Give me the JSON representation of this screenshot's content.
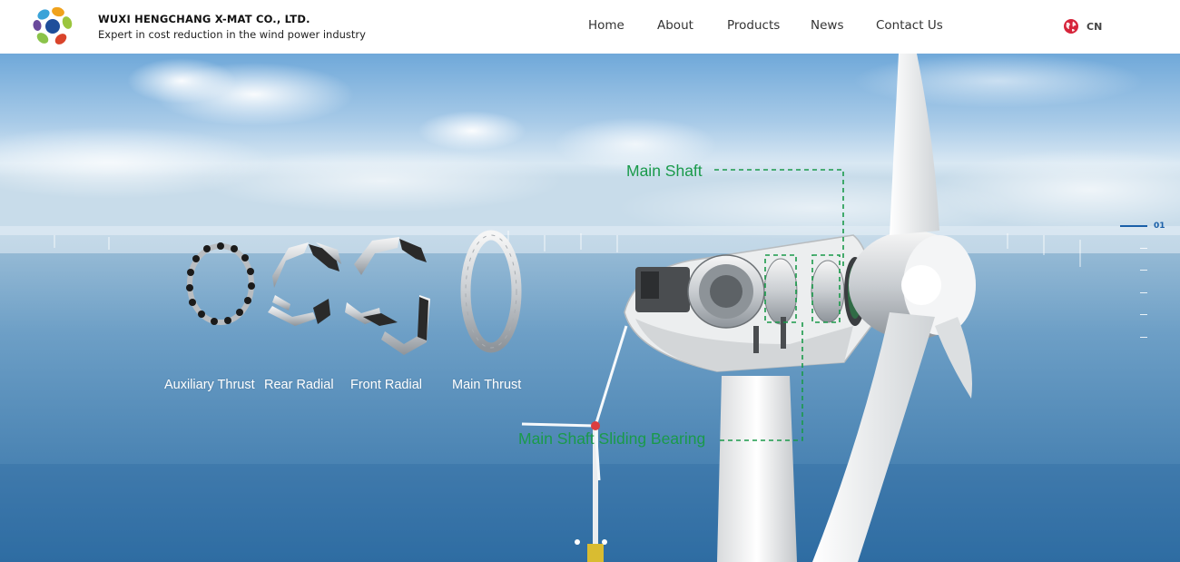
{
  "header": {
    "company_name": "WUXI HENGCHANG X-MAT CO., LTD.",
    "tagline": "Expert in cost reduction in the wind power industry",
    "logo_icon": "petal-logo-icon"
  },
  "nav": {
    "items": [
      {
        "label": "Home"
      },
      {
        "label": "About"
      },
      {
        "label": "Products"
      },
      {
        "label": "News"
      },
      {
        "label": "Contact Us"
      }
    ]
  },
  "language": {
    "label": "CN",
    "icon": "globe-icon",
    "color": "#d6243a"
  },
  "hero": {
    "callouts": {
      "main_shaft": "Main Shaft",
      "main_shaft_sliding_bearing": "Main Shaft Sliding Bearing"
    },
    "bearings": [
      {
        "label": "Auxiliary Thrust"
      },
      {
        "label": "Rear Radial"
      },
      {
        "label": "Front Radial"
      },
      {
        "label": "Main Thrust"
      }
    ],
    "slide_indicator": {
      "current": "01"
    },
    "accent_color": "#1a9a4a"
  },
  "colors": {
    "callout_green": "#1a9a4a",
    "indicator_blue": "#1a5fa8",
    "sky_top": "#7fb3de",
    "sea": "#3f7fb2"
  }
}
